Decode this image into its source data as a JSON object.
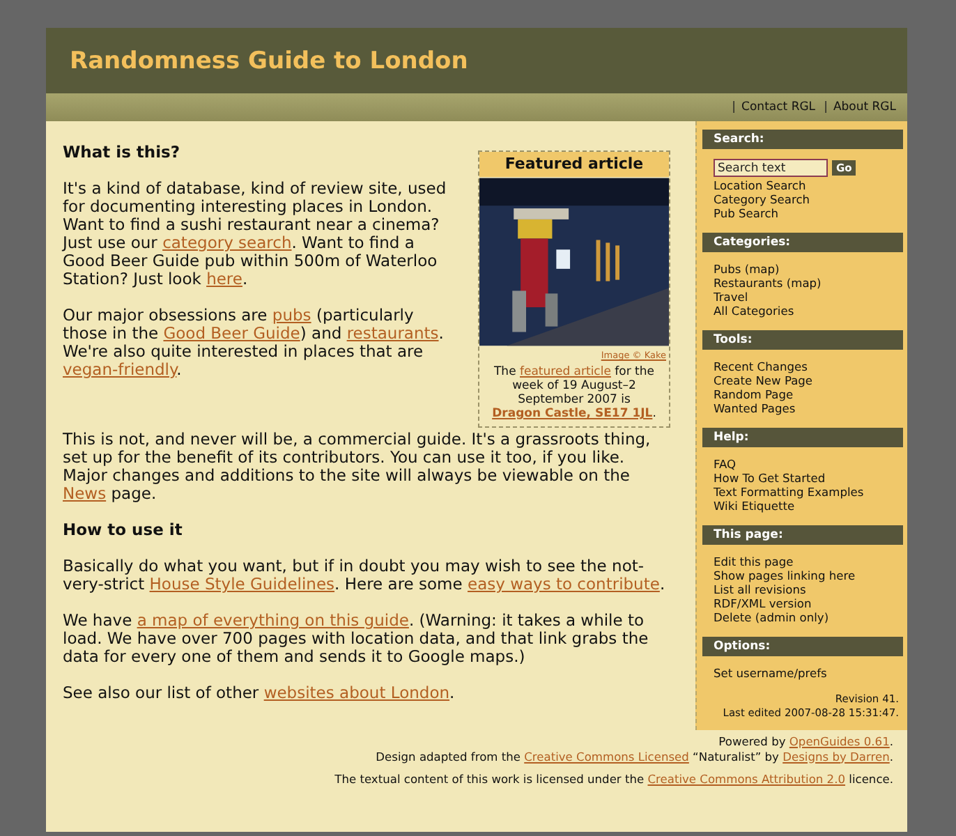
{
  "site_title": "Randomness Guide to London",
  "top_links": [
    {
      "separator": "|",
      "label": "Contact RGL"
    },
    {
      "separator": "|",
      "label": "About RGL"
    }
  ],
  "featured": {
    "title": "Featured article",
    "image_credit": "Image © Kake",
    "caption": [
      {
        "kind": "text",
        "text": "The "
      },
      {
        "kind": "link",
        "text": "featured article"
      },
      {
        "kind": "text",
        "text": " for the week of 19 August–2 September 2007 is "
      },
      {
        "kind": "strong_link",
        "text": "Dragon Castle, SE17 1JL"
      },
      {
        "kind": "text",
        "text": "."
      }
    ]
  },
  "sections": [
    {
      "heading": "What is this?",
      "paragraphs": [
        [
          {
            "kind": "text",
            "text": "It's a kind of database, kind of review site, used for documenting interesting places in London. Want to find a sushi restaurant near a cinema? Just use our "
          },
          {
            "kind": "link",
            "text": "category search"
          },
          {
            "kind": "text",
            "text": ". Want to find a Good Beer Guide pub within 500m of Waterloo Station? Just look "
          },
          {
            "kind": "link",
            "text": "here"
          },
          {
            "kind": "text",
            "text": "."
          }
        ],
        [
          {
            "kind": "text",
            "text": "Our major obsessions are "
          },
          {
            "kind": "link",
            "text": "pubs"
          },
          {
            "kind": "text",
            "text": " (particularly those in the "
          },
          {
            "kind": "link",
            "text": "Good Beer Guide"
          },
          {
            "kind": "text",
            "text": ") and "
          },
          {
            "kind": "link",
            "text": "restaurants"
          },
          {
            "kind": "text",
            "text": ". We're also quite interested in places that are "
          },
          {
            "kind": "link",
            "text": "vegan-friendly"
          },
          {
            "kind": "text",
            "text": "."
          }
        ],
        [
          {
            "kind": "text",
            "text": "This is not, and never will be, a commercial guide. It's a grassroots thing, set up for the benefit of its contributors. You can use it too, if you like. Major changes and additions to the site will always be viewable on the "
          },
          {
            "kind": "link",
            "text": "News"
          },
          {
            "kind": "text",
            "text": " page."
          }
        ]
      ]
    },
    {
      "heading": "How to use it",
      "paragraphs": [
        [
          {
            "kind": "text",
            "text": "Basically do what you want, but if in doubt you may wish to see the not-very-strict "
          },
          {
            "kind": "link",
            "text": "House Style Guidelines"
          },
          {
            "kind": "text",
            "text": ". Here are some "
          },
          {
            "kind": "link",
            "text": "easy ways to contribute"
          },
          {
            "kind": "text",
            "text": "."
          }
        ],
        [
          {
            "kind": "text",
            "text": "We have "
          },
          {
            "kind": "link",
            "text": "a map of everything on this guide"
          },
          {
            "kind": "text",
            "text": ". (Warning: it takes a while to load. We have over 700 pages with location data, and that link grabs the data for every one of them and sends it to Google maps.)"
          }
        ],
        [
          {
            "kind": "text",
            "text": "See also our list of other "
          },
          {
            "kind": "link",
            "text": "websites about London"
          },
          {
            "kind": "text",
            "text": "."
          }
        ]
      ]
    }
  ],
  "sidebar": {
    "search": {
      "heading": "Search:",
      "placeholder": "Search text",
      "button": "Go",
      "links": [
        "Location Search",
        "Category Search",
        "Pub Search"
      ]
    },
    "blocks": [
      {
        "heading": "Categories:",
        "items": [
          "Pubs (map)",
          "Restaurants (map)",
          "Travel",
          "All Categories"
        ]
      },
      {
        "heading": "Tools:",
        "items": [
          "Recent Changes",
          "Create New Page",
          "Random Page",
          "Wanted Pages"
        ]
      },
      {
        "heading": "Help:",
        "items": [
          "FAQ",
          "How To Get Started",
          "Text Formatting Examples",
          "Wiki Etiquette"
        ]
      },
      {
        "heading": "This page:",
        "items": [
          "Edit this page",
          "Show pages linking here",
          "List all revisions",
          "RDF/XML version",
          "Delete (admin only)"
        ]
      },
      {
        "heading": "Options:",
        "items": [
          "Set username/prefs"
        ]
      }
    ],
    "revision": "Revision 41.",
    "last_edited": "Last edited 2007-08-28 15:31:47."
  },
  "footer": [
    [
      {
        "kind": "text",
        "text": "Powered by "
      },
      {
        "kind": "link",
        "text": "OpenGuides 0.61"
      },
      {
        "kind": "text",
        "text": "."
      }
    ],
    [
      {
        "kind": "text",
        "text": "Design adapted from the "
      },
      {
        "kind": "link",
        "text": "Creative Commons Licensed"
      },
      {
        "kind": "text",
        "text": " “Naturalist” by "
      },
      {
        "kind": "link",
        "text": "Designs by Darren"
      },
      {
        "kind": "text",
        "text": "."
      }
    ],
    [
      {
        "kind": "text",
        "text": "The textual content of this work is licensed under the "
      },
      {
        "kind": "link",
        "text": "Creative Commons Attribution 2.0"
      },
      {
        "kind": "text",
        "text": " licence."
      }
    ]
  ]
}
